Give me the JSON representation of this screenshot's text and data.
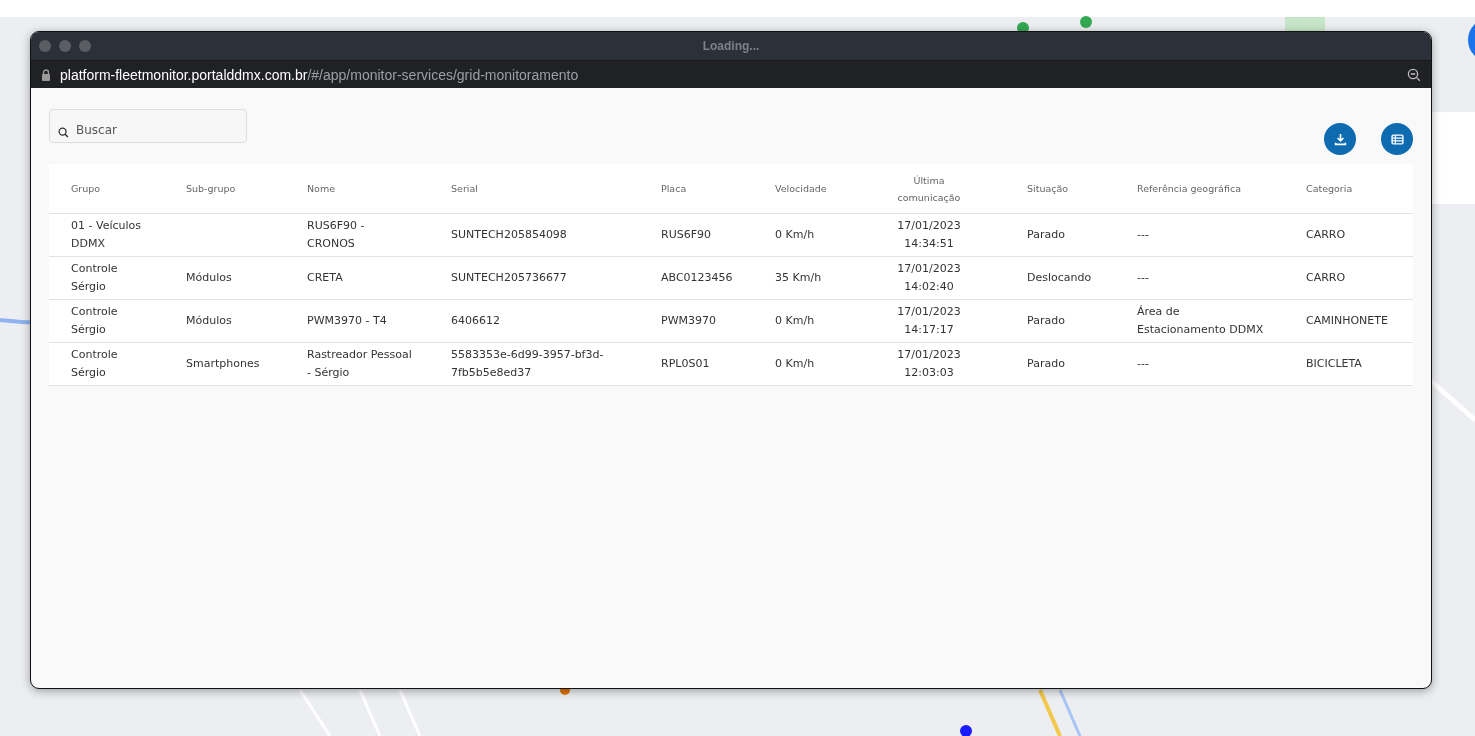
{
  "window": {
    "title": "Loading..."
  },
  "address_bar": {
    "host": "platform-fleetmonitor.portalddmx.com.br",
    "path": "/#/app/monitor-services/grid-monitoramento"
  },
  "search": {
    "placeholder": "Buscar"
  },
  "table": {
    "columns": [
      "Grupo",
      "Sub-grupo",
      "Nome",
      "Serial",
      "Placa",
      "Velocidade",
      "Última comunicação",
      "Situação",
      "Referência geográfica",
      "Categoria"
    ],
    "rows": [
      [
        "01 - Veículos DDMX",
        "",
        "RUS6F90 - CRONOS",
        "SUNTECH205854098",
        "RUS6F90",
        "0 Km/h",
        "17/01/2023 14:34:51",
        "Parado",
        "---",
        "CARRO"
      ],
      [
        "Controle Sérgio",
        "Módulos",
        "CRETA",
        "SUNTECH205736677",
        "ABC0123456",
        "35 Km/h",
        "17/01/2023 14:02:40",
        "Deslocando",
        "---",
        "CARRO"
      ],
      [
        "Controle Sérgio",
        "Módulos",
        "PWM3970 - T4",
        "6406612",
        "PWM3970",
        "0 Km/h",
        "17/01/2023 14:17:17",
        "Parado",
        "Área de Estacionamento DDMX",
        "CAMINHONETE"
      ],
      [
        "Controle Sérgio",
        "Smartphones",
        "Rastreador Pessoal - Sérgio",
        "5583353e-6d99-3957-bf3d-7fb5b5e8ed37",
        "RPL0S01",
        "0 Km/h",
        "17/01/2023 12:03:03",
        "Parado",
        "---",
        "BICICLETA"
      ]
    ]
  }
}
